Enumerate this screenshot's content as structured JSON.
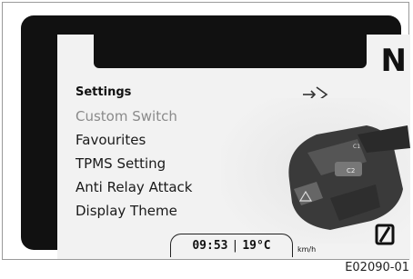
{
  "gear": "N",
  "menu": {
    "title": "Settings",
    "items": [
      {
        "label": "Custom Switch",
        "selected": true
      },
      {
        "label": "Favourites",
        "selected": false
      },
      {
        "label": "TPMS Setting",
        "selected": false
      },
      {
        "label": "Anti Relay Attack",
        "selected": false
      },
      {
        "label": "Display Theme",
        "selected": false
      }
    ]
  },
  "status": {
    "time": "09:53",
    "separator": "|",
    "temperature": "19°C",
    "speed_unit": "km/h"
  },
  "icons": {
    "enter": "enter-arrow-icon",
    "speed": "speed-display-icon"
  },
  "figure_code": "E02090-01"
}
